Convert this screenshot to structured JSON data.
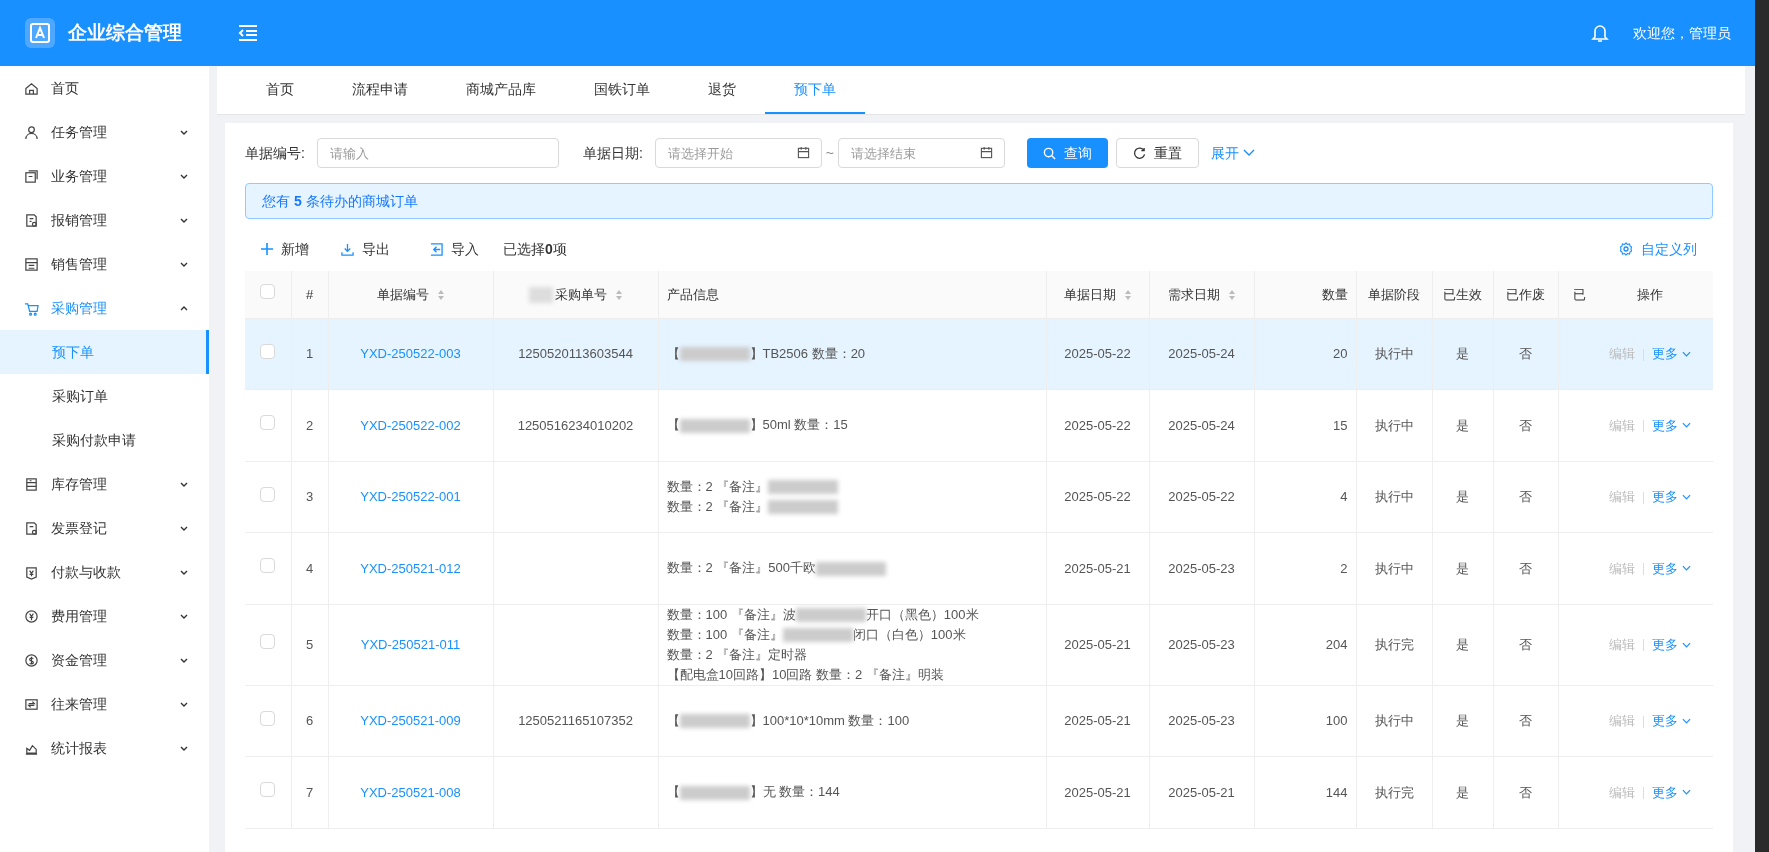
{
  "app": {
    "title": "企业综合管理",
    "welcome": "欢迎您，管理员"
  },
  "sidebar": {
    "items": [
      {
        "label": "首页",
        "has_children": false,
        "expanded": false
      },
      {
        "label": "任务管理",
        "has_children": true,
        "expanded": false
      },
      {
        "label": "业务管理",
        "has_children": true,
        "expanded": false
      },
      {
        "label": "报销管理",
        "has_children": true,
        "expanded": false
      },
      {
        "label": "销售管理",
        "has_children": true,
        "expanded": false
      },
      {
        "label": "采购管理",
        "has_children": true,
        "expanded": true,
        "children": [
          {
            "label": "预下单",
            "selected": true
          },
          {
            "label": "采购订单",
            "selected": false
          },
          {
            "label": "采购付款申请",
            "selected": false
          }
        ]
      },
      {
        "label": "库存管理",
        "has_children": true,
        "expanded": false
      },
      {
        "label": "发票登记",
        "has_children": true,
        "expanded": false
      },
      {
        "label": "付款与收款",
        "has_children": true,
        "expanded": false
      },
      {
        "label": "费用管理",
        "has_children": true,
        "expanded": false
      },
      {
        "label": "资金管理",
        "has_children": true,
        "expanded": false
      },
      {
        "label": "往来管理",
        "has_children": true,
        "expanded": false
      },
      {
        "label": "统计报表",
        "has_children": true,
        "expanded": false
      }
    ]
  },
  "tabs": [
    {
      "label": "首页",
      "selected": false
    },
    {
      "label": "流程申请",
      "selected": false
    },
    {
      "label": "商城产品库",
      "selected": false
    },
    {
      "label": "国铁订单",
      "selected": false
    },
    {
      "label": "退货",
      "selected": false
    },
    {
      "label": "预下单",
      "selected": true
    }
  ],
  "filters": {
    "number_label": "单据编号:",
    "number_placeholder": "请输入",
    "date_label": "单据日期:",
    "start_placeholder": "请选择开始",
    "separator": "~",
    "end_placeholder": "请选择结束",
    "search_button": "查询",
    "reset_button": "重置",
    "expand_link": "展开"
  },
  "alert": "您有 **5** 条待办的商城订单",
  "toolbar": {
    "add": "新增",
    "export": "导出",
    "import": "导入",
    "selected_info": "已选择**0**项",
    "columns_setting": "自定义列"
  },
  "table": {
    "header_checked": false,
    "columns": [
      {
        "label": "#",
        "sortable": false,
        "redacted_prefix": false
      },
      {
        "label": "单据编号",
        "sortable": true,
        "redacted_prefix": false
      },
      {
        "label": "采购单号",
        "sortable": true,
        "redacted_prefix": true
      },
      {
        "label": "产品信息",
        "sortable": false,
        "redacted_prefix": false
      },
      {
        "label": "单据日期",
        "sortable": true,
        "redacted_prefix": false
      },
      {
        "label": "需求日期",
        "sortable": true,
        "redacted_prefix": false
      },
      {
        "label": "数量",
        "sortable": false,
        "redacted_prefix": false
      },
      {
        "label": "单据阶段",
        "sortable": false,
        "redacted_prefix": false
      },
      {
        "label": "已生效",
        "sortable": false,
        "redacted_prefix": false
      },
      {
        "label": "已作废",
        "sortable": false,
        "redacted_prefix": false
      },
      {
        "label": "已",
        "sortable": false,
        "redacted_prefix": false
      },
      {
        "label": "操作",
        "sortable": false,
        "redacted_prefix": false
      }
    ],
    "rows": [
      {
        "index": "1",
        "number": "YXD-250522-003",
        "purchase_no": "1250520113603544",
        "product": [
          [
            {
              "kind": "text",
              "text": "【"
            },
            {
              "kind": "redacted"
            },
            {
              "kind": "text",
              "text": "】TB2506 数量：20"
            }
          ]
        ],
        "date": "2025-05-22",
        "need_date": "2025-05-24",
        "qty": "20",
        "stage": "执行中",
        "effective": "是",
        "void": "否",
        "edit": "编辑",
        "more": "更多",
        "checked": false,
        "selected": true
      },
      {
        "index": "2",
        "number": "YXD-250522-002",
        "purchase_no": "1250516234010202",
        "product": [
          [
            {
              "kind": "text",
              "text": "【"
            },
            {
              "kind": "redacted"
            },
            {
              "kind": "text",
              "text": "】50ml 数量：15"
            }
          ]
        ],
        "date": "2025-05-22",
        "need_date": "2025-05-24",
        "qty": "15",
        "stage": "执行中",
        "effective": "是",
        "void": "否",
        "edit": "编辑",
        "more": "更多",
        "checked": false,
        "selected": false
      },
      {
        "index": "3",
        "number": "YXD-250522-001",
        "product": [
          [
            {
              "kind": "text",
              "text": "数量：2 『备注』"
            },
            {
              "kind": "redacted"
            }
          ],
          [
            {
              "kind": "text",
              "text": "数量：2 『备注』"
            },
            {
              "kind": "redacted"
            }
          ]
        ],
        "date": "2025-05-22",
        "need_date": "2025-05-22",
        "qty": "4",
        "stage": "执行中",
        "effective": "是",
        "void": "否",
        "edit": "编辑",
        "more": "更多",
        "checked": false,
        "selected": false
      },
      {
        "index": "4",
        "number": "YXD-250521-012",
        "product": [
          [
            {
              "kind": "text",
              "text": "数量：2 『备注』500千欧"
            },
            {
              "kind": "redacted"
            }
          ]
        ],
        "date": "2025-05-21",
        "need_date": "2025-05-23",
        "qty": "2",
        "stage": "执行中",
        "effective": "是",
        "void": "否",
        "edit": "编辑",
        "more": "更多",
        "checked": false,
        "selected": false
      },
      {
        "index": "5",
        "number": "YXD-250521-011",
        "product": [
          [
            {
              "kind": "text",
              "text": "数量：100 『备注』波"
            },
            {
              "kind": "redacted"
            },
            {
              "kind": "text",
              "text": "开口（黑色）100米"
            }
          ],
          [
            {
              "kind": "text",
              "text": "数量：100 『备注』"
            },
            {
              "kind": "redacted"
            },
            {
              "kind": "text",
              "text": "闭口（白色）100米"
            }
          ],
          [
            {
              "kind": "text",
              "text": "数量：2 『备注』定时器"
            }
          ],
          [
            {
              "kind": "text",
              "text": "【配电盒10回路】10回路 数量：2 『备注』明装"
            }
          ]
        ],
        "date": "2025-05-21",
        "need_date": "2025-05-23",
        "qty": "204",
        "stage": "执行完",
        "effective": "是",
        "void": "否",
        "edit": "编辑",
        "more": "更多",
        "checked": false,
        "selected": false
      },
      {
        "index": "6",
        "number": "YXD-250521-009",
        "purchase_no": "1250521165107352",
        "product": [
          [
            {
              "kind": "text",
              "text": "【"
            },
            {
              "kind": "redacted"
            },
            {
              "kind": "text",
              "text": "】100*10*10mm 数量：100"
            }
          ]
        ],
        "date": "2025-05-21",
        "need_date": "2025-05-23",
        "qty": "100",
        "stage": "执行中",
        "effective": "是",
        "void": "否",
        "edit": "编辑",
        "more": "更多",
        "checked": false,
        "selected": false
      },
      {
        "index": "7",
        "number": "YXD-250521-008",
        "product": [
          [
            {
              "kind": "text",
              "text": "【"
            },
            {
              "kind": "redacted"
            },
            {
              "kind": "text",
              "text": "】无 数量：144"
            }
          ]
        ],
        "date": "2025-05-21",
        "need_date": "2025-05-21",
        "qty": "144",
        "stage": "执行完",
        "effective": "是",
        "void": "否",
        "edit": "编辑",
        "more": "更多",
        "checked": false,
        "selected": false
      }
    ]
  }
}
